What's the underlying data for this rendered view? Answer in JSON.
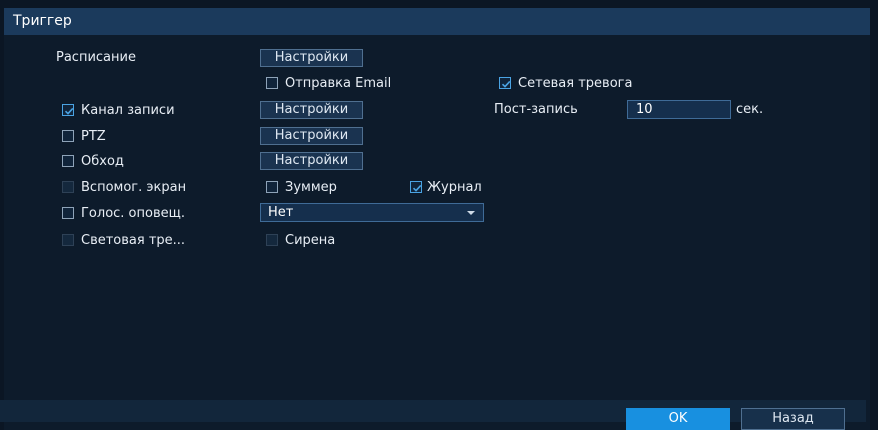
{
  "dialog": {
    "title": "Триггер"
  },
  "schedule": {
    "label": "Расписание",
    "button": "Настройки"
  },
  "email": {
    "label": "Отправка Email",
    "checked": false
  },
  "network_alarm": {
    "label": "Сетевая тревога",
    "checked": true
  },
  "record_channel": {
    "label": "Канал записи",
    "checked": true,
    "button": "Настройки"
  },
  "post_record": {
    "label": "Пост-запись",
    "value": "10",
    "unit": "сек."
  },
  "ptz": {
    "label": "PTZ",
    "checked": false,
    "button": "Настройки"
  },
  "tour": {
    "label": "Обход",
    "checked": false,
    "button": "Настройки"
  },
  "aux_screen": {
    "label": "Вспомог. экран",
    "checked": false,
    "disabled": true
  },
  "buzzer": {
    "label": "Зуммер",
    "checked": false
  },
  "log": {
    "label": "Журнал",
    "checked": true
  },
  "voice_alert": {
    "label": "Голос. оповещ.",
    "checked": false,
    "selected": "Нет"
  },
  "light_alarm": {
    "label": "Световая тре...",
    "checked": false,
    "disabled": true
  },
  "siren": {
    "label": "Сирена",
    "checked": false,
    "disabled": true
  },
  "footer": {
    "ok_label": "OK",
    "back_label": "Назад"
  },
  "colors": {
    "accent": "#1890e0",
    "title_bar": "#1b3a5c",
    "background": "#0d1b2b",
    "check": "#4aa3e3"
  }
}
